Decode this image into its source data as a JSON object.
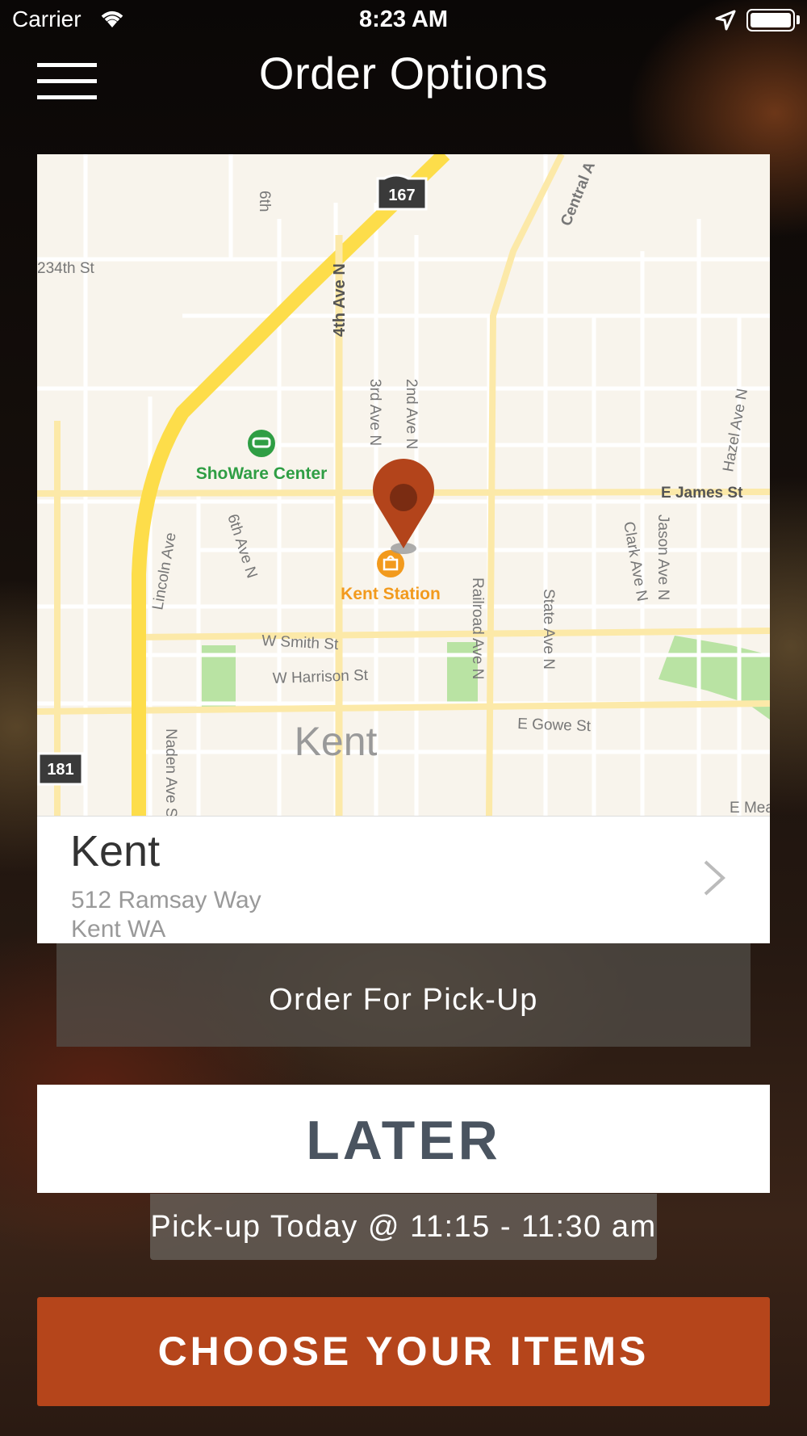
{
  "status_bar": {
    "carrier": "Carrier",
    "time": "8:23 AM"
  },
  "header": {
    "title": "Order Options"
  },
  "map": {
    "labels": {
      "hwy_167": "167",
      "hwy_181": "181",
      "central": "Central A",
      "sixth_top": "6th",
      "s234": "234th St",
      "fourth": "4th Ave N",
      "third": "3rd Ave N",
      "second": "2nd Ave N",
      "hazel": "Hazel Ave N",
      "showare": "ShoWare Center",
      "ejames": "E James St",
      "lincoln": "Lincoln Ave",
      "sixth": "6th Ave N",
      "kent_station": "Kent Station",
      "railroad": "Railroad Ave N",
      "state": "State Ave N",
      "clark": "Clark Ave N",
      "jason": "Jason Ave N",
      "wsmith": "W Smith St",
      "wharrison": "W Harrison St",
      "egowe": "E Gowe St",
      "kent": "Kent",
      "naden": "Naden Ave S",
      "emea": "E Mea"
    },
    "colors": {
      "land": "#f8f4ec",
      "highway": "#fddd4a",
      "arterial": "#fce9a8",
      "street": "#ffffff",
      "park": "#b9e3a3",
      "pin": "#b3441b",
      "poi_green": "#2f9e44",
      "poi_orange": "#f29a1d"
    }
  },
  "location": {
    "name": "Kent",
    "street": "512 Ramsay Way",
    "city": "Kent WA"
  },
  "order_type": {
    "label": "Order For Pick-Up"
  },
  "timing": {
    "label": "LATER",
    "pickup_time": "Pick-up Today @ 11:15 - 11:30 am"
  },
  "cta": {
    "label": "CHOOSE YOUR ITEMS"
  }
}
